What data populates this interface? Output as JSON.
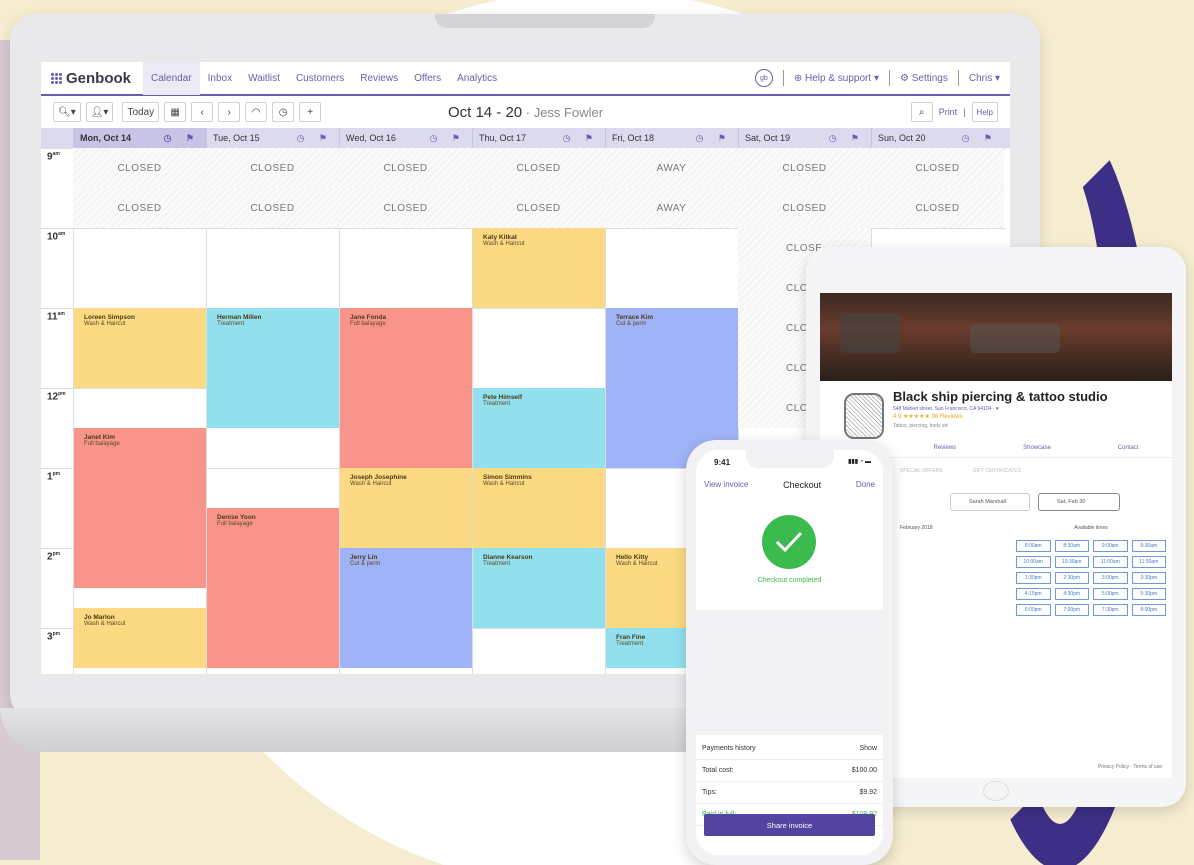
{
  "app": {
    "name": "Genbook"
  },
  "nav": {
    "items": [
      "Calendar",
      "Inbox",
      "Waitlist",
      "Customers",
      "Reviews",
      "Offers",
      "Analytics"
    ],
    "help": "Help & support ▾",
    "settings": "Settings",
    "user": "Chris ▾",
    "round_icon_text": "gb"
  },
  "toolbar": {
    "today": "Today",
    "title": "Oct 14 - 20",
    "staff": " · Jess Fowler",
    "print": "Print",
    "help": "Help"
  },
  "days": [
    "Mon, Oct 14",
    "Tue, Oct 15",
    "Wed, Oct 16",
    "Thu, Oct 17",
    "Fri, Oct 18",
    "Sat, Oct 19",
    "Sun, Oct 20"
  ],
  "hours": {
    "h9": "9",
    "h10": "10",
    "h11": "11",
    "h12": "12",
    "h1": "1",
    "h2": "2",
    "h3": "3",
    "am": "am",
    "pm": "pm"
  },
  "closed_labels": {
    "mon": "CLOSED",
    "tue": "CLOSED",
    "wed": "CLOSED",
    "thu": "CLOSED",
    "fri": "AWAY",
    "sat": "CLOSED",
    "sun": "CLOSED",
    "sat_partial": "CLOSE",
    "sat_short": "CLO"
  },
  "appointments": [
    {
      "name": "Katy Kitkat",
      "service": "Wash & Haircut"
    },
    {
      "name": "Loreen Simpson",
      "service": "Wash & Haircut"
    },
    {
      "name": "Herman Millen",
      "service": "Treatment"
    },
    {
      "name": "Jane Fonda",
      "service": "Full balayage"
    },
    {
      "name": "Terrace Kim",
      "service": "Cut & perm"
    },
    {
      "name": "Pete Himself",
      "service": "Treatment"
    },
    {
      "name": "Janet Kim",
      "service": "Full balayage"
    },
    {
      "name": "Joseph Josephine",
      "service": "Wash & Haircut"
    },
    {
      "name": "Simon Simmins",
      "service": "Wash & Haircut"
    },
    {
      "name": "Denise Yoon",
      "service": "Full balayage"
    },
    {
      "name": "Jerry Lin",
      "service": "Cut & perm"
    },
    {
      "name": "Dianne Kearson",
      "service": "Treatment"
    },
    {
      "name": "Hello Kitty",
      "service": "Wash & Haircut"
    },
    {
      "name": "Jo Marlon",
      "service": "Wash & Haircut"
    },
    {
      "name": "Fran Fine",
      "service": "Treatment"
    }
  ],
  "tablet": {
    "title": "Black ship piercing & tattoo studio",
    "address": "548 Market street, San Francisco, CA 94104 · ♥",
    "stars": "4.9 ★★★★★  98 Reviews",
    "tags": "Tattoo, piercing, body art",
    "links": [
      "Reviews",
      "Showcase",
      "Contact"
    ],
    "filters": [
      "SPECIAL OFFERS",
      "GIFT CERTIFICATES"
    ],
    "staff_field": "Sarah Marshall",
    "date_field": "Sat, Feb 30",
    "month": "February 2018",
    "available": "Available times",
    "slots": [
      "8:00am",
      "8:30am",
      "9:00am",
      "9:30am",
      "10:00am",
      "10:30am",
      "11:00am",
      "11:30am",
      "1:30pm",
      "2:30pm",
      "3:00pm",
      "3:30pm",
      "4:15pm",
      "4:30pm",
      "5:00pm",
      "5:30pm",
      "6:00pm",
      "7:00pm",
      "7:30pm",
      "8:00pm"
    ],
    "footer": "Privacy Policy · Terms of use"
  },
  "phone": {
    "time": "9:41",
    "signal": "▮▮▮ ◔ ▬",
    "view_invoice": "View invoice",
    "checkout": "Checkout",
    "done": "Done",
    "completed": "Checkout completed",
    "payments_history": "Payments history",
    "show": "Show",
    "total_label": "Total cost:",
    "total": "$100.00",
    "tips_label": "Tips:",
    "tips": "$9.92",
    "paid_label": "Paid in full:",
    "paid": "$109.92",
    "share": "Share invoice"
  }
}
